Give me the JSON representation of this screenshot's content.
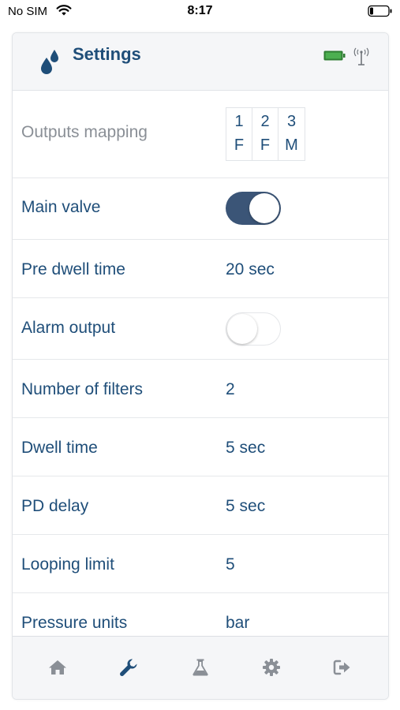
{
  "status_bar": {
    "carrier": "No SIM",
    "time": "8:17"
  },
  "header": {
    "title": "Settings",
    "logo_icon": "water-drops-icon",
    "battery_icon": "battery-full-icon",
    "antenna_icon": "antenna-icon"
  },
  "colors": {
    "accent": "#1f4e79",
    "toggle_on": "#3b5577",
    "battery_green": "#3aa53a",
    "muted_label": "#8a8f96"
  },
  "rows": [
    {
      "label": "Outputs mapping",
      "type": "mapping",
      "mapping": [
        {
          "top": "1",
          "bottom": "F"
        },
        {
          "top": "2",
          "bottom": "F"
        },
        {
          "top": "3",
          "bottom": "M"
        }
      ]
    },
    {
      "label": "Main valve",
      "type": "toggle",
      "on": true
    },
    {
      "label": "Pre dwell time",
      "type": "value",
      "value": "20 sec"
    },
    {
      "label": "Alarm output",
      "type": "toggle",
      "on": false
    },
    {
      "label": "Number of filters",
      "type": "value",
      "value": "2"
    },
    {
      "label": "Dwell time",
      "type": "value",
      "value": "5 sec"
    },
    {
      "label": "PD delay",
      "type": "value",
      "value": "5 sec"
    },
    {
      "label": "Looping limit",
      "type": "value",
      "value": "5"
    },
    {
      "label": "Pressure units",
      "type": "value",
      "value": "bar"
    }
  ],
  "tabbar": {
    "tabs": [
      {
        "icon": "home-icon",
        "active": false
      },
      {
        "icon": "wrench-icon",
        "active": true
      },
      {
        "icon": "flask-icon",
        "active": false
      },
      {
        "icon": "gear-icon",
        "active": false
      },
      {
        "icon": "logout-icon",
        "active": false
      }
    ]
  }
}
